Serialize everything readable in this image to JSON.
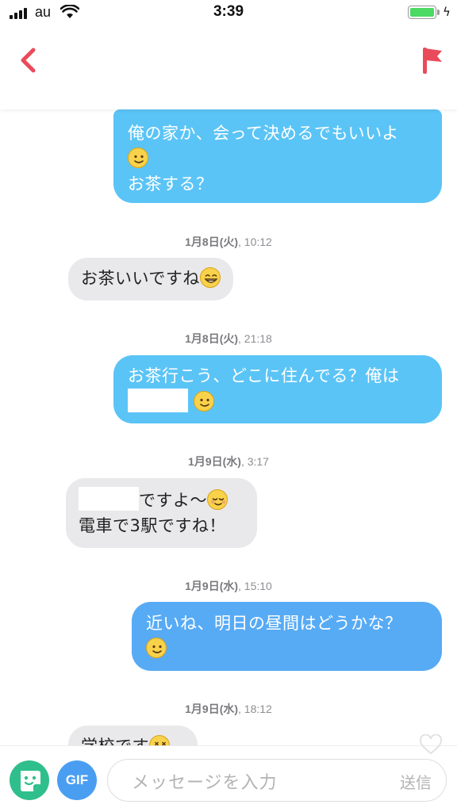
{
  "status_bar": {
    "carrier": "au",
    "time": "3:39"
  },
  "header": {
    "back_icon": "chevron-left-icon",
    "report_icon": "flag-icon",
    "accent_color": "#e94b5b"
  },
  "messages": [
    {
      "type": "outgoing",
      "lines": [
        "俺の家か、会って決めるでもいいよ",
        "🙂",
        "お茶する？"
      ]
    },
    {
      "type": "timestamp",
      "date": "1月8日(火)",
      "time": ", 10:12"
    },
    {
      "type": "incoming",
      "text": "お茶いいですね",
      "emoji": "grin-icon"
    },
    {
      "type": "timestamp",
      "date": "1月8日(火)",
      "time": ", 21:18"
    },
    {
      "type": "outgoing",
      "lines": [
        "お茶行こう、どこに住んでる？俺は",
        "🙂"
      ]
    },
    {
      "type": "timestamp",
      "date": "1月9日(水)",
      "time": ", 3:17"
    },
    {
      "type": "incoming",
      "lines": [
        "ですよ〜",
        "電車で3駅ですね！"
      ]
    },
    {
      "type": "timestamp",
      "date": "1月9日(水)",
      "time": ", 15:10"
    },
    {
      "type": "outgoing",
      "lines": [
        "近いね、明日の昼間はどうかな？",
        "🙂"
      ]
    },
    {
      "type": "timestamp",
      "date": "1月9日(水)",
      "time": ", 18:12"
    },
    {
      "type": "incoming",
      "text": "学校です"
    }
  ],
  "input_bar": {
    "gif_label": "GIF",
    "placeholder": "メッセージを入力",
    "send_label": "送信",
    "sticker_color": "#2fbf8c",
    "gif_color": "#4a9ef2"
  },
  "colors": {
    "outgoing_bubble": "#5bc4f6",
    "incoming_bubble": "#e9e9eb"
  }
}
